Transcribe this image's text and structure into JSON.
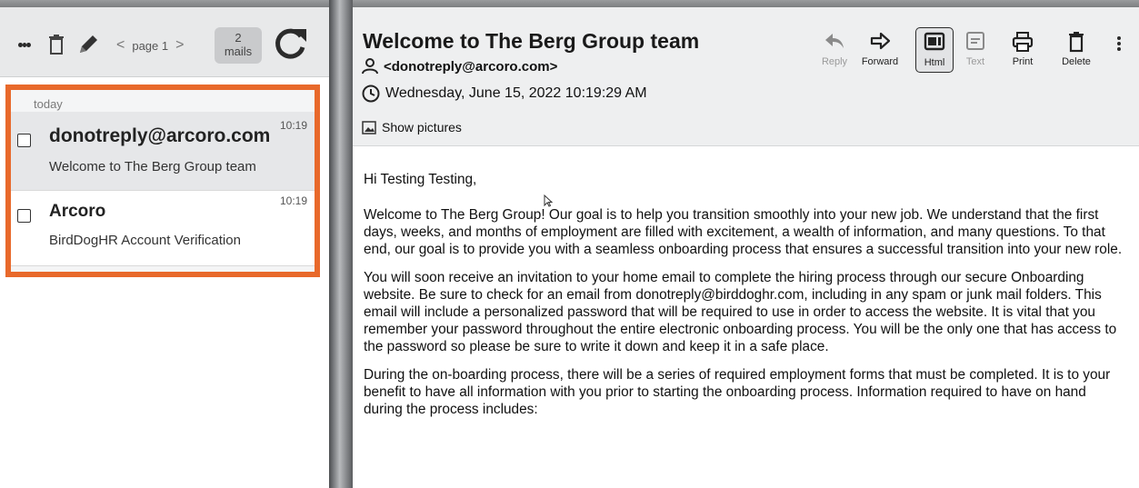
{
  "left_toolbar": {
    "page_label": "page 1",
    "prev_label": "<",
    "next_label": ">",
    "count_number": "2",
    "count_unit": "mails"
  },
  "mail_list": {
    "group_label": "today",
    "items": [
      {
        "sender": "donotreply@arcoro.com",
        "time": "10:19",
        "subject": "Welcome to The Berg Group team"
      },
      {
        "sender": "Arcoro",
        "time": "10:19",
        "subject": "BirdDogHR Account Verification"
      }
    ]
  },
  "message": {
    "title": "Welcome to The Berg Group team",
    "from": "<donotreply@arcoro.com>",
    "date": "Wednesday, June 15, 2022 10:19:29 AM",
    "show_pictures": "Show pictures",
    "actions": {
      "reply": "Reply",
      "forward": "Forward",
      "html": "Html",
      "text": "Text",
      "print": "Print",
      "delete": "Delete"
    },
    "greeting": "Hi Testing Testing,",
    "paragraphs": [
      "Welcome to The Berg Group! Our goal is to help you transition smoothly into your new job. We understand that the first days, weeks, and months of employment are filled with excitement, a wealth of information, and many questions. To that end, our goal is to provide you with a seamless onboarding process that ensures a successful transition into your new role.",
      "You will soon receive an invitation to your home email to complete the hiring process through our secure Onboarding website. Be sure to check for an email from donotreply@birddoghr.com, including in any spam or junk mail folders. This email will include a personalized password that will be required to use in order to access the website. It is vital that you remember your password throughout the entire electronic onboarding process. You will be the only one that has access to the password so please be sure to write it down and keep it in a safe place.",
      "During the on-boarding process, there will be a series of required employment forms that must be completed. It is to your benefit to have all information with you prior to starting the onboarding process. Information required to have on hand during the process includes:"
    ]
  },
  "colors": {
    "highlight_frame": "#e8692b",
    "toolbar_bg": "#e8e9ea",
    "header_bg": "#eeeff0"
  }
}
